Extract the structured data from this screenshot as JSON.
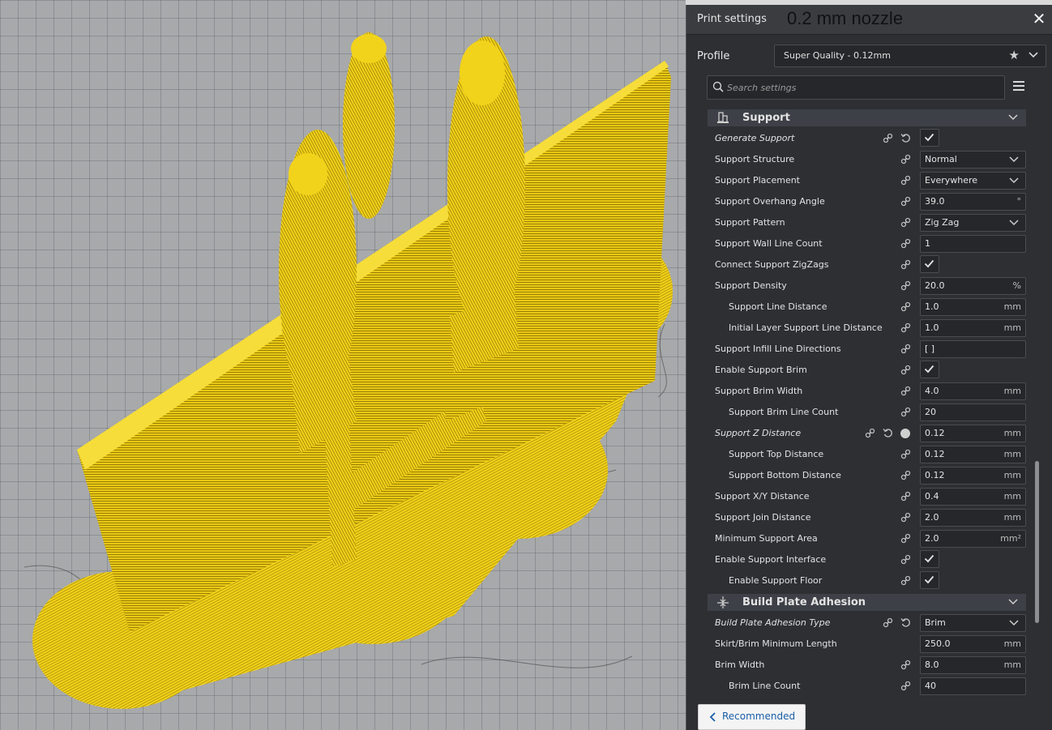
{
  "panel": {
    "title": "Print settings",
    "annotation": "0.2 mm nozzle",
    "close_glyph": "✕",
    "profile_label": "Profile",
    "profile_value": "Super Quality - 0.12mm",
    "search_placeholder": "Search settings",
    "recommended_label": "Recommended"
  },
  "sections": {
    "support": "Support",
    "adhesion": "Build Plate Adhesion"
  },
  "rows": [
    {
      "label": "Generate Support",
      "italic": true,
      "indent": 0,
      "type": "check",
      "reset": true,
      "link": true
    },
    {
      "label": "Support Structure",
      "indent": 0,
      "type": "select",
      "value": "Normal",
      "link": true
    },
    {
      "label": "Support Placement",
      "indent": 0,
      "type": "select",
      "value": "Everywhere",
      "link": true
    },
    {
      "label": "Support Overhang Angle",
      "indent": 0,
      "type": "field",
      "value": "39.0",
      "unit": "°",
      "link": true
    },
    {
      "label": "Support Pattern",
      "indent": 0,
      "type": "select",
      "value": "Zig Zag",
      "link": true
    },
    {
      "label": "Support Wall Line Count",
      "indent": 0,
      "type": "field",
      "value": "1",
      "unit": "",
      "link": true
    },
    {
      "label": "Connect Support ZigZags",
      "indent": 0,
      "type": "check",
      "link": true
    },
    {
      "label": "Support Density",
      "indent": 0,
      "type": "field",
      "value": "20.0",
      "unit": "%",
      "link": true
    },
    {
      "label": "Support Line Distance",
      "indent": 1,
      "type": "field",
      "value": "1.0",
      "unit": "mm",
      "link": true
    },
    {
      "label": "Initial Layer Support Line Distance",
      "indent": 1,
      "type": "field",
      "value": "1.0",
      "unit": "mm",
      "link": true
    },
    {
      "label": "Support Infill Line Directions",
      "indent": 0,
      "type": "field",
      "value": "[ ]",
      "unit": "",
      "link": true
    },
    {
      "label": "Enable Support Brim",
      "indent": 0,
      "type": "check",
      "link": true
    },
    {
      "label": "Support Brim Width",
      "indent": 0,
      "type": "field",
      "value": "4.0",
      "unit": "mm",
      "link": true
    },
    {
      "label": "Support Brim Line Count",
      "indent": 1,
      "type": "field",
      "value": "20",
      "unit": "",
      "link": true
    },
    {
      "label": "Support Z Distance",
      "italic": true,
      "indent": 0,
      "type": "field",
      "value": "0.12",
      "unit": "mm",
      "link": true,
      "reset": true,
      "fx": true
    },
    {
      "label": "Support Top Distance",
      "indent": 1,
      "type": "field",
      "value": "0.12",
      "unit": "mm",
      "link": true
    },
    {
      "label": "Support Bottom Distance",
      "indent": 1,
      "type": "field",
      "value": "0.12",
      "unit": "mm",
      "link": true
    },
    {
      "label": "Support X/Y Distance",
      "indent": 0,
      "type": "field",
      "value": "0.4",
      "unit": "mm",
      "link": true
    },
    {
      "label": "Support Join Distance",
      "indent": 0,
      "type": "field",
      "value": "2.0",
      "unit": "mm",
      "link": true
    },
    {
      "label": "Minimum Support Area",
      "indent": 0,
      "type": "field",
      "value": "2.0",
      "unit": "mm²",
      "link": true
    },
    {
      "label": "Enable Support Interface",
      "indent": 0,
      "type": "check",
      "link": true
    },
    {
      "label": "Enable Support Floor",
      "indent": 1,
      "type": "check",
      "link": true
    }
  ],
  "adhesion_rows": [
    {
      "label": "Build Plate Adhesion Type",
      "italic": true,
      "indent": 0,
      "type": "select",
      "value": "Brim",
      "link": true,
      "reset": true
    },
    {
      "label": "Skirt/Brim Minimum Length",
      "indent": 0,
      "type": "field",
      "value": "250.0",
      "unit": "mm",
      "link": false
    },
    {
      "label": "Brim Width",
      "indent": 0,
      "type": "field",
      "value": "8.0",
      "unit": "mm",
      "link": true
    },
    {
      "label": "Brim Line Count",
      "indent": 1,
      "type": "field",
      "value": "40",
      "unit": "",
      "link": true
    }
  ],
  "colors": {
    "model": "#f2d31b",
    "model_shade": "#b89a0a",
    "panel_bg": "#2d2f33",
    "accent_link": "#1a5ea8"
  }
}
